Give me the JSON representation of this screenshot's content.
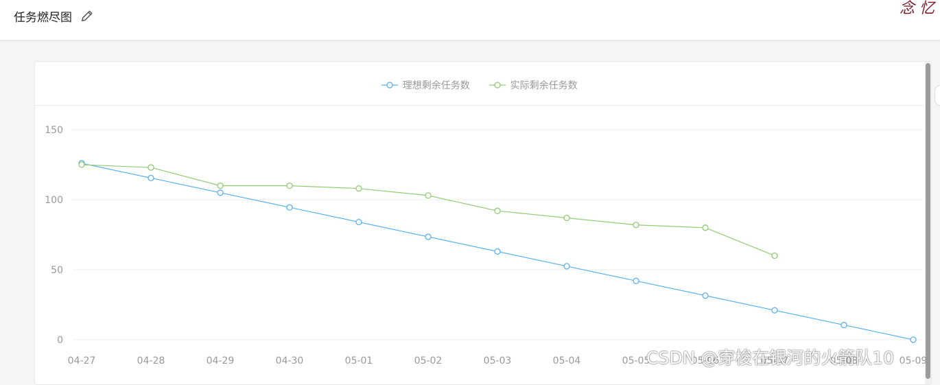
{
  "header": {
    "title": "任务燃尽图",
    "edit_icon": "pencil-icon"
  },
  "colors": {
    "ideal": "#5ab1ef",
    "actual": "#91cc75",
    "axis_text": "#999999",
    "grid": "#ececec"
  },
  "watermark": "CSDN @穿梭在银河的火箭队10",
  "chart_data": {
    "type": "line",
    "categories": [
      "04-27",
      "04-28",
      "04-29",
      "04-30",
      "05-01",
      "05-02",
      "05-03",
      "05-04",
      "05-05",
      "05-06",
      "05-07",
      "05-08",
      "05-09"
    ],
    "category_labels": [
      "04-27",
      "04-28",
      "04-29",
      "04-30",
      "05-01",
      "05-02",
      "05-03",
      "05-04",
      "05-05",
      "05-06",
      "05-07",
      "05-08",
      "05-09"
    ],
    "ylim": [
      0,
      150
    ],
    "yticks": [
      0,
      50,
      100,
      150
    ],
    "grid": true,
    "legend_position": "top-center",
    "series": [
      {
        "name": "理想剩余任务数",
        "values": [
          126,
          115.5,
          105,
          94.5,
          84,
          73.5,
          63,
          52.5,
          42,
          31.5,
          21,
          10.5,
          0
        ]
      },
      {
        "name": "实际剩余任务数",
        "values": [
          125,
          123,
          110,
          110,
          108,
          103,
          92,
          87,
          82,
          80,
          60,
          null,
          null
        ]
      }
    ]
  }
}
